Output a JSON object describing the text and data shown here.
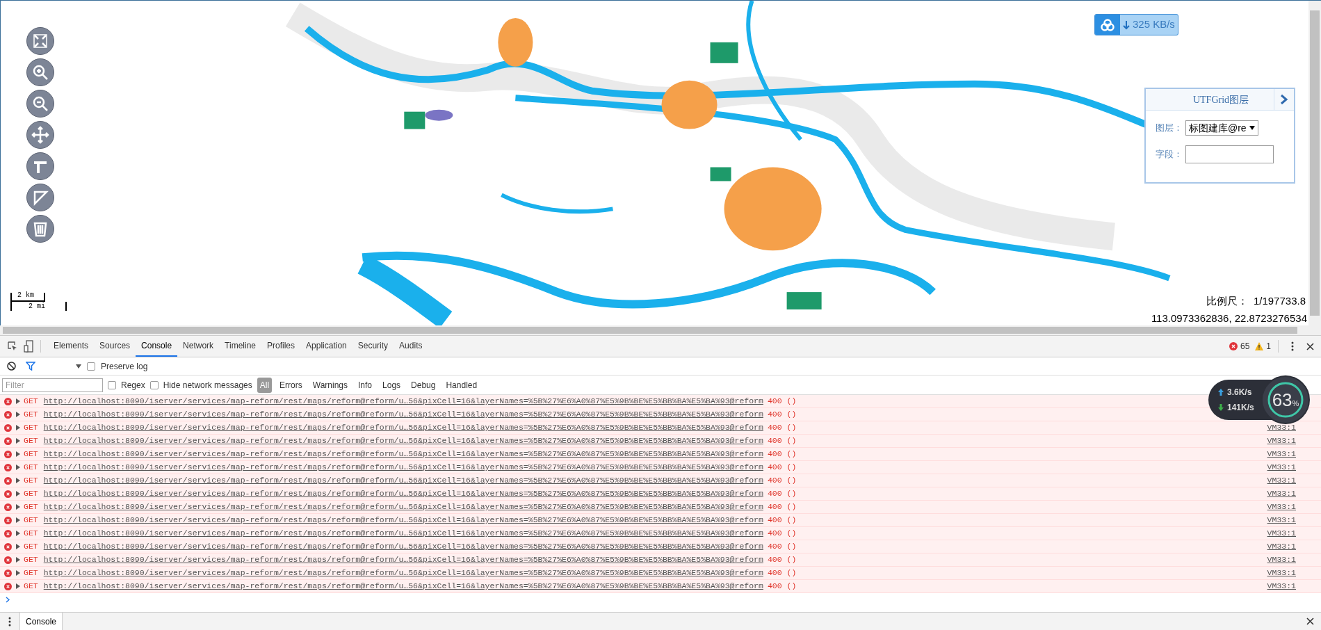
{
  "map": {
    "scale_bar": {
      "top": "2 km",
      "bottom": "2 mi"
    },
    "download_badge": {
      "speed": "325 KB/s"
    },
    "utfgrid_panel": {
      "title": "UTFGrid图层",
      "layer_label": "图层：",
      "layer_value": "标图建库@re",
      "field_label": "字段："
    },
    "scale": {
      "label": "比例尺：",
      "value": "1/197733.8"
    },
    "coordinates": "113.0973362836, 22.8723276534"
  },
  "devtools": {
    "tabs": [
      {
        "label": "Elements",
        "selected": false
      },
      {
        "label": "Sources",
        "selected": false
      },
      {
        "label": "Console",
        "selected": true
      },
      {
        "label": "Network",
        "selected": false
      },
      {
        "label": "Timeline",
        "selected": false
      },
      {
        "label": "Profiles",
        "selected": false
      },
      {
        "label": "Application",
        "selected": false
      },
      {
        "label": "Security",
        "selected": false
      },
      {
        "label": "Audits",
        "selected": false
      }
    ],
    "error_count": "65",
    "warning_count": "1",
    "preserve_log": {
      "label": "Preserve log",
      "checked": false
    },
    "filter": {
      "placeholder": "Filter"
    },
    "regex": {
      "label": "Regex",
      "checked": false
    },
    "hide_network": {
      "label": "Hide network messages",
      "checked": false
    },
    "levels": [
      {
        "label": "All",
        "selected": true
      },
      {
        "label": "Errors",
        "selected": false
      },
      {
        "label": "Warnings",
        "selected": false
      },
      {
        "label": "Info",
        "selected": false
      },
      {
        "label": "Logs",
        "selected": false
      },
      {
        "label": "Debug",
        "selected": false
      },
      {
        "label": "Handled",
        "selected": false
      }
    ],
    "rows": [
      {
        "method": "GET",
        "url": "http://localhost:8090/iserver/services/map-reform/rest/maps/reform@reform/u…56&pixCell=16&layerNames=%5B%27%E6%A0%87%E5%9B%BE%E5%BB%BA%E5%BA%93@reform",
        "status": "400 ()"
      },
      {
        "method": "GET",
        "url": "http://localhost:8090/iserver/services/map-reform/rest/maps/reform@reform/u…56&pixCell=16&layerNames=%5B%27%E6%A0%87%E5%9B%BE%E5%BB%BA%E5%BA%93@reform",
        "status": "400 ()"
      },
      {
        "method": "GET",
        "url": "http://localhost:8090/iserver/services/map-reform/rest/maps/reform@reform/u…56&pixCell=16&layerNames=%5B%27%E6%A0%87%E5%9B%BE%E5%BB%BA%E5%BA%93@reform",
        "status": "400 ()",
        "source": "VM33:1"
      },
      {
        "method": "GET",
        "url": "http://localhost:8090/iserver/services/map-reform/rest/maps/reform@reform/u…56&pixCell=16&layerNames=%5B%27%E6%A0%87%E5%9B%BE%E5%BB%BA%E5%BA%93@reform",
        "status": "400 ()",
        "source": "VM33:1"
      },
      {
        "method": "GET",
        "url": "http://localhost:8090/iserver/services/map-reform/rest/maps/reform@reform/u…56&pixCell=16&layerNames=%5B%27%E6%A0%87%E5%9B%BE%E5%BB%BA%E5%BA%93@reform",
        "status": "400 ()",
        "source": "VM33:1"
      },
      {
        "method": "GET",
        "url": "http://localhost:8090/iserver/services/map-reform/rest/maps/reform@reform/u…56&pixCell=16&layerNames=%5B%27%E6%A0%87%E5%9B%BE%E5%BB%BA%E5%BA%93@reform",
        "status": "400 ()",
        "source": "VM33:1"
      },
      {
        "method": "GET",
        "url": "http://localhost:8090/iserver/services/map-reform/rest/maps/reform@reform/u…56&pixCell=16&layerNames=%5B%27%E6%A0%87%E5%9B%BE%E5%BB%BA%E5%BA%93@reform",
        "status": "400 ()",
        "source": "VM33:1"
      },
      {
        "method": "GET",
        "url": "http://localhost:8090/iserver/services/map-reform/rest/maps/reform@reform/u…56&pixCell=16&layerNames=%5B%27%E6%A0%87%E5%9B%BE%E5%BB%BA%E5%BA%93@reform",
        "status": "400 ()",
        "source": "VM33:1"
      },
      {
        "method": "GET",
        "url": "http://localhost:8090/iserver/services/map-reform/rest/maps/reform@reform/u…56&pixCell=16&layerNames=%5B%27%E6%A0%87%E5%9B%BE%E5%BB%BA%E5%BA%93@reform",
        "status": "400 ()",
        "source": "VM33:1"
      },
      {
        "method": "GET",
        "url": "http://localhost:8090/iserver/services/map-reform/rest/maps/reform@reform/u…56&pixCell=16&layerNames=%5B%27%E6%A0%87%E5%9B%BE%E5%BB%BA%E5%BA%93@reform",
        "status": "400 ()",
        "source": "VM33:1"
      },
      {
        "method": "GET",
        "url": "http://localhost:8090/iserver/services/map-reform/rest/maps/reform@reform/u…56&pixCell=16&layerNames=%5B%27%E6%A0%87%E5%9B%BE%E5%BB%BA%E5%BA%93@reform",
        "status": "400 ()",
        "source": "VM33:1"
      },
      {
        "method": "GET",
        "url": "http://localhost:8090/iserver/services/map-reform/rest/maps/reform@reform/u…56&pixCell=16&layerNames=%5B%27%E6%A0%87%E5%9B%BE%E5%BB%BA%E5%BA%93@reform",
        "status": "400 ()",
        "source": "VM33:1"
      },
      {
        "method": "GET",
        "url": "http://localhost:8090/iserver/services/map-reform/rest/maps/reform@reform/u…56&pixCell=16&layerNames=%5B%27%E6%A0%87%E5%9B%BE%E5%BB%BA%E5%BA%93@reform",
        "status": "400 ()",
        "source": "VM33:1"
      },
      {
        "method": "GET",
        "url": "http://localhost:8090/iserver/services/map-reform/rest/maps/reform@reform/u…56&pixCell=16&layerNames=%5B%27%E6%A0%87%E5%9B%BE%E5%BB%BA%E5%BA%93@reform",
        "status": "400 ()",
        "source": "VM33:1"
      },
      {
        "method": "GET",
        "url": "http://localhost:8090/iserver/services/map-reform/rest/maps/reform@reform/u…56&pixCell=16&layerNames=%5B%27%E6%A0%87%E5%9B%BE%E5%BB%BA%E5%BA%93@reform",
        "status": "400 ()",
        "source": "VM33:1"
      }
    ],
    "drawer_tab": "Console"
  },
  "net_widget": {
    "up": "3.6K/s",
    "down": "141K/s",
    "percent": "63",
    "unit": "%"
  }
}
